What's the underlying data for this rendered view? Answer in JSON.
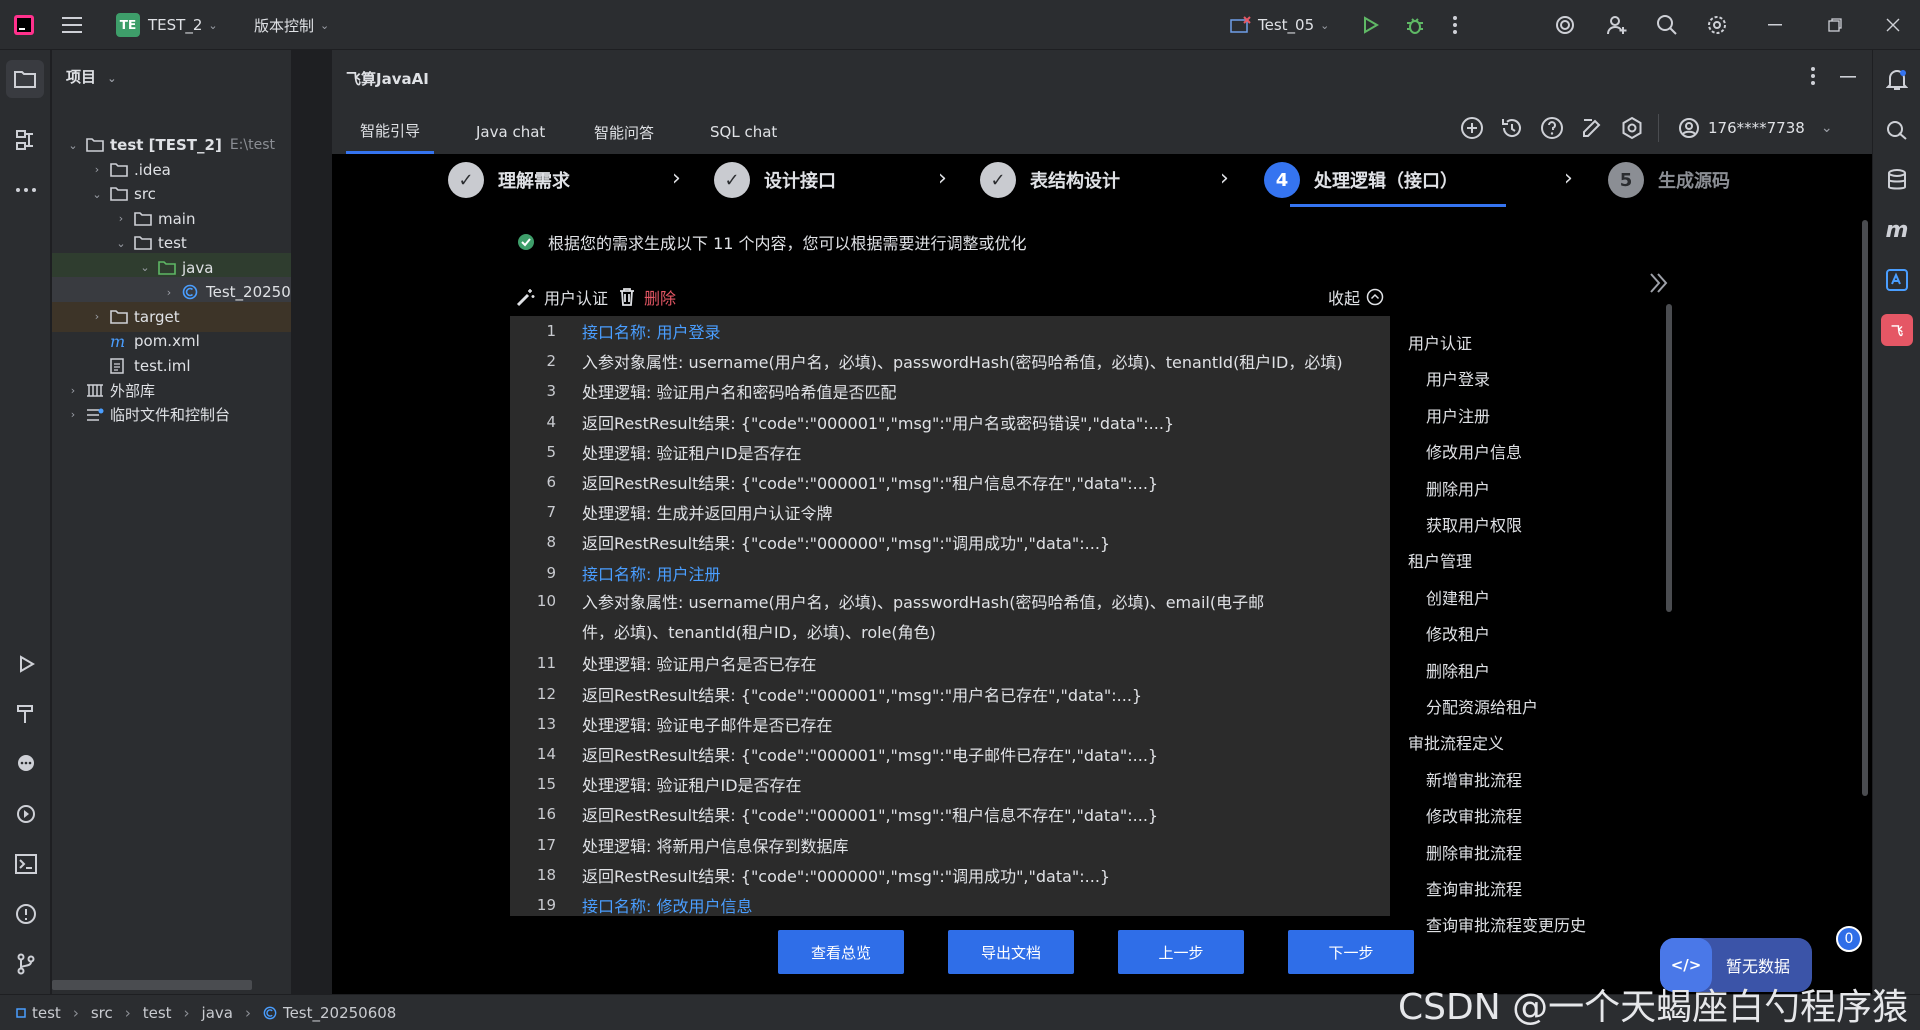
{
  "titlebar": {
    "project_badge": "TE",
    "project_name": "TEST_2",
    "vcs_label": "版本控制",
    "run_config": "Test_05"
  },
  "project_panel": {
    "title": "项目",
    "tree": [
      {
        "label": "test [TEST_2]",
        "hint": "E:\\test",
        "arrow": "⌄",
        "indent": 14
      },
      {
        "label": ".idea",
        "arrow": "›",
        "indent": 38
      },
      {
        "label": "src",
        "arrow": "⌄",
        "indent": 38
      },
      {
        "label": "main",
        "arrow": "›",
        "indent": 62
      },
      {
        "label": "test",
        "arrow": "⌄",
        "indent": 62
      },
      {
        "label": "java",
        "arrow": "⌄",
        "indent": 86
      },
      {
        "label": "Test_20250",
        "arrow": "›",
        "indent": 110
      },
      {
        "label": "target",
        "arrow": "›",
        "indent": 38
      },
      {
        "label": "pom.xml",
        "arrow": "",
        "indent": 38
      },
      {
        "label": "test.iml",
        "arrow": "",
        "indent": 38
      },
      {
        "label": "外部库",
        "arrow": "›",
        "indent": 14
      },
      {
        "label": "临时文件和控制台",
        "arrow": "›",
        "indent": 14
      }
    ]
  },
  "plugin": {
    "title": "飞算JavaAI",
    "tabs": [
      "智能引导",
      "Java chat",
      "智能问答",
      "SQL chat"
    ],
    "account": "176****7738",
    "steps": [
      {
        "label": "理解需求",
        "mark": "✓",
        "state": "done"
      },
      {
        "label": "设计接口",
        "mark": "✓",
        "state": "done"
      },
      {
        "label": "表结构设计",
        "mark": "✓",
        "state": "done"
      },
      {
        "label": "处理逻辑（接口）",
        "mark": "4",
        "state": "active"
      },
      {
        "label": "生成源码",
        "mark": "5",
        "state": "pending"
      }
    ],
    "note": "根据您的需求生成以下 11 个内容，您可以根据需要进行调整或优化",
    "section_title": "用户认证",
    "delete_label": "删除",
    "collapse_label": "收起",
    "code_lines": [
      {
        "n": "1",
        "text": "接口名称: 用户登录",
        "link": true
      },
      {
        "n": "2",
        "text": "入参对象属性: username(用户名，必填)、passwordHash(密码哈希值，必填)、tenantId(租户ID，必填)"
      },
      {
        "n": "3",
        "text": "处理逻辑: 验证用户名和密码哈希值是否匹配"
      },
      {
        "n": "4",
        "text": "返回RestResult结果: {\"code\":\"000001\",\"msg\":\"用户名或密码错误\",\"data\":...}"
      },
      {
        "n": "5",
        "text": "处理逻辑: 验证租户ID是否存在"
      },
      {
        "n": "6",
        "text": "返回RestResult结果: {\"code\":\"000001\",\"msg\":\"租户信息不存在\",\"data\":...}"
      },
      {
        "n": "7",
        "text": "处理逻辑: 生成并返回用户认证令牌"
      },
      {
        "n": "8",
        "text": "返回RestResult结果: {\"code\":\"000000\",\"msg\":\"调用成功\",\"data\":...}"
      },
      {
        "n": "9",
        "text": "接口名称: 用户注册",
        "link": true
      },
      {
        "n": "10",
        "text": "入参对象属性: username(用户名，必填)、passwordHash(密码哈希值，必填)、email(电子邮件，必填)、tenantId(租户ID，必填)、role(角色)",
        "tall": true
      },
      {
        "n": "11",
        "text": "处理逻辑: 验证用户名是否已存在"
      },
      {
        "n": "12",
        "text": "返回RestResult结果: {\"code\":\"000001\",\"msg\":\"用户名已存在\",\"data\":...}"
      },
      {
        "n": "13",
        "text": "处理逻辑: 验证电子邮件是否已存在"
      },
      {
        "n": "14",
        "text": "返回RestResult结果: {\"code\":\"000001\",\"msg\":\"电子邮件已存在\",\"data\":...}"
      },
      {
        "n": "15",
        "text": "处理逻辑: 验证租户ID是否存在"
      },
      {
        "n": "16",
        "text": "返回RestResult结果: {\"code\":\"000001\",\"msg\":\"租户信息不存在\",\"data\":...}"
      },
      {
        "n": "17",
        "text": "处理逻辑: 将新用户信息保存到数据库"
      },
      {
        "n": "18",
        "text": "返回RestResult结果: {\"code\":\"000000\",\"msg\":\"调用成功\",\"data\":...}"
      },
      {
        "n": "19",
        "text": "接口名称: 修改用户信息",
        "link": true
      }
    ],
    "outline": [
      {
        "label": "用户认证",
        "level": 0
      },
      {
        "label": "用户登录",
        "level": 1
      },
      {
        "label": "用户注册",
        "level": 1
      },
      {
        "label": "修改用户信息",
        "level": 1
      },
      {
        "label": "删除用户",
        "level": 1
      },
      {
        "label": "获取用户权限",
        "level": 1
      },
      {
        "label": "租户管理",
        "level": 0
      },
      {
        "label": "创建租户",
        "level": 1
      },
      {
        "label": "修改租户",
        "level": 1
      },
      {
        "label": "删除租户",
        "level": 1
      },
      {
        "label": "分配资源给租户",
        "level": 1
      },
      {
        "label": "审批流程定义",
        "level": 0
      },
      {
        "label": "新增审批流程",
        "level": 1
      },
      {
        "label": "修改审批流程",
        "level": 1
      },
      {
        "label": "删除审批流程",
        "level": 1
      },
      {
        "label": "查询审批流程",
        "level": 1
      },
      {
        "label": "查询审批流程变更历史",
        "level": 1
      }
    ],
    "buttons": [
      "查看总览",
      "导出文档",
      "上一步",
      "下一步"
    ],
    "no_data_label": "暂无数据",
    "no_data_count": "0"
  },
  "statusbar": {
    "crumbs": [
      "test",
      "src",
      "test",
      "java",
      "Test_20250608"
    ]
  },
  "watermark": "CSDN @一个天蝎座白勺程序猿",
  "colors": {
    "accent": "#3574f0",
    "link": "#4a9eff",
    "danger": "#e55765",
    "success": "#3e9e6a"
  }
}
